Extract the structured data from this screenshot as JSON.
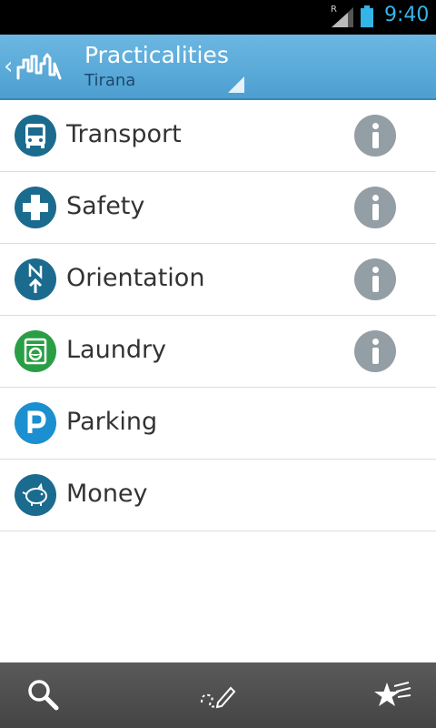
{
  "status_bar": {
    "signal_label": "R",
    "time": "9:40",
    "accent_color": "#33b5e5"
  },
  "action_bar": {
    "title": "Practicalities",
    "subtitle": "Tirana",
    "up_icon": "chevron-left-icon",
    "logo_icon": "city-skyline-logo-icon"
  },
  "list": {
    "items": [
      {
        "label": "Transport",
        "icon": "bus-icon",
        "icon_color": "#1b6b8f",
        "has_info": true
      },
      {
        "label": "Safety",
        "icon": "medical-cross-icon",
        "icon_color": "#1b6b8f",
        "has_info": true
      },
      {
        "label": "Orientation",
        "icon": "north-arrow-icon",
        "icon_color": "#1b6b8f",
        "has_info": true
      },
      {
        "label": "Laundry",
        "icon": "washing-machine-icon",
        "icon_color": "#2a9e44",
        "has_info": true
      },
      {
        "label": "Parking",
        "icon": "parking-icon",
        "icon_color": "#1b8fcf",
        "has_info": false
      },
      {
        "label": "Money",
        "icon": "piggy-bank-icon",
        "icon_color": "#1b6b8f",
        "has_info": false
      }
    ],
    "info_icon": "info-icon"
  },
  "bottom_bar": {
    "buttons": [
      "search-icon",
      "route-pencil-icon",
      "stars-icon"
    ]
  }
}
